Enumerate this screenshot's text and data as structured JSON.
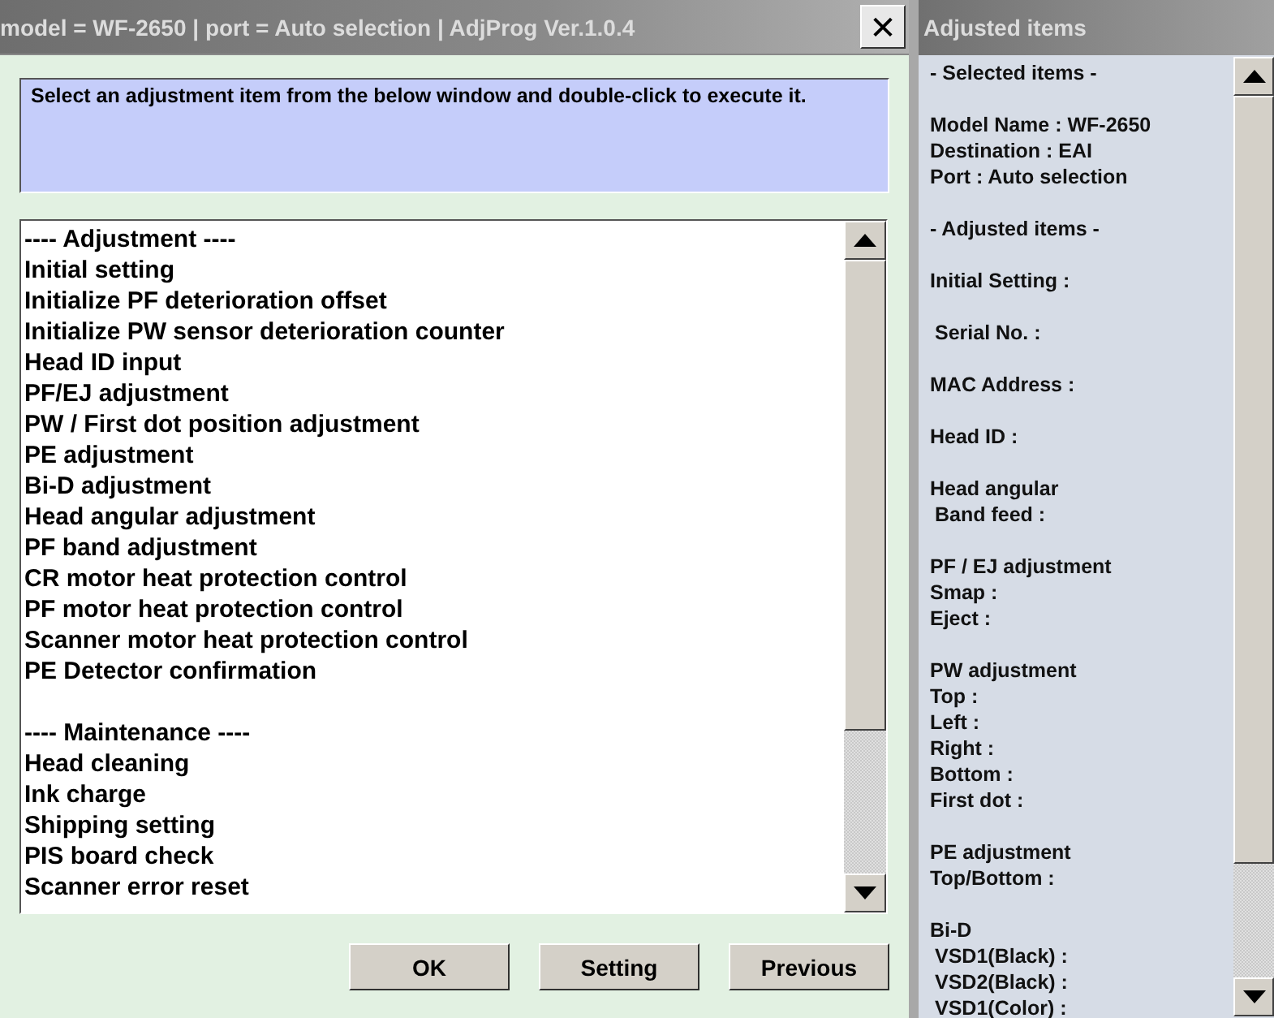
{
  "window": {
    "title": "model = WF-2650 | port = Auto selection | AdjProg Ver.1.0.4",
    "close": "✕"
  },
  "instruction": "Select an adjustment item from the below window and double-click to execute it.",
  "list": {
    "groups": [
      {
        "items": [
          "---- Adjustment ----",
          "Initial setting",
          "Initialize PF deterioration offset",
          "Initialize PW sensor deterioration counter",
          "Head ID input",
          "PF/EJ adjustment",
          "PW / First dot position adjustment",
          "PE adjustment",
          "Bi-D adjustment",
          "Head angular adjustment",
          "PF band adjustment",
          "CR motor heat protection control",
          "PF motor heat protection control",
          "Scanner motor heat protection control",
          "PE Detector confirmation"
        ]
      },
      {
        "items": [
          "---- Maintenance ----",
          "Head cleaning",
          "Ink charge",
          "Shipping setting",
          "PIS board check",
          "Scanner error reset"
        ]
      }
    ]
  },
  "buttons": [
    "OK",
    "Setting",
    "Previous"
  ],
  "side_panel": {
    "title": "Adjusted items",
    "groups": [
      {
        "lines": [
          {
            "text": "- Selected items -",
            "indented": false
          }
        ]
      },
      {
        "lines": [
          {
            "text": "Model Name : WF-2650",
            "indented": false
          },
          {
            "text": "Destination : EAI",
            "indented": false
          },
          {
            "text": "Port : Auto selection",
            "indented": false
          }
        ]
      },
      {
        "lines": [
          {
            "text": "- Adjusted items -",
            "indented": false
          }
        ]
      },
      {
        "lines": [
          {
            "text": "Initial Setting :",
            "indented": false
          }
        ]
      },
      {
        "lines": [
          {
            "text": "Serial No. :",
            "indented": true
          }
        ]
      },
      {
        "lines": [
          {
            "text": "MAC Address :",
            "indented": false
          }
        ]
      },
      {
        "lines": [
          {
            "text": "Head ID :",
            "indented": false
          }
        ]
      },
      {
        "lines": [
          {
            "text": "Head angular",
            "indented": false
          },
          {
            "text": "Band feed :",
            "indented": true
          }
        ]
      },
      {
        "lines": [
          {
            "text": "PF / EJ adjustment",
            "indented": false
          },
          {
            "text": "Smap :",
            "indented": false
          },
          {
            "text": "Eject :",
            "indented": false
          }
        ]
      },
      {
        "lines": [
          {
            "text": "PW adjustment",
            "indented": false
          },
          {
            "text": "Top :",
            "indented": false
          },
          {
            "text": "Left :",
            "indented": false
          },
          {
            "text": "Right :",
            "indented": false
          },
          {
            "text": "Bottom :",
            "indented": false
          },
          {
            "text": "First dot :",
            "indented": false
          }
        ]
      },
      {
        "lines": [
          {
            "text": "PE adjustment",
            "indented": false
          },
          {
            "text": "Top/Bottom :",
            "indented": false
          }
        ]
      },
      {
        "lines": [
          {
            "text": "Bi-D",
            "indented": false
          },
          {
            "text": "VSD1(Black) :",
            "indented": true
          },
          {
            "text": "VSD2(Black) :",
            "indented": true
          },
          {
            "text": "VSD1(Color) :",
            "indented": true
          }
        ]
      }
    ]
  }
}
